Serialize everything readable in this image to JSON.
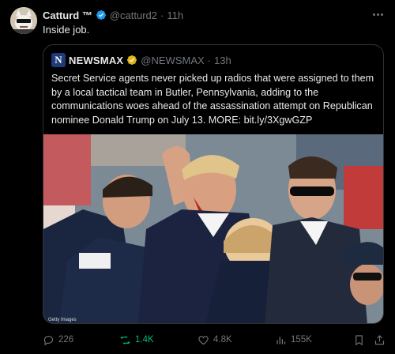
{
  "tweet": {
    "author_name": "Catturd ™",
    "handle": "@catturd2",
    "separator": "·",
    "time": "11h",
    "text": "Inside job."
  },
  "quote": {
    "logo_letter": "N",
    "author_name": "NEWSMAX",
    "handle": "@NEWSMAX",
    "separator": "·",
    "time": "13h",
    "text": "Secret Service agents never picked up radios that were assigned to them by a local tactical team in Butler, Pennsylvania, adding to the communications woes ahead of the assassination attempt on Republican nominee Donald Trump on July 13. MORE: bit.ly/3XgwGZP",
    "photo_credit": "Getty Images"
  },
  "actions": {
    "replies": "226",
    "retweets": "1.4K",
    "likes": "4.8K",
    "views": "155K"
  },
  "colors": {
    "background": "#000000",
    "text": "#e7e9ea",
    "muted": "#71767b",
    "verified_blue": "#1d9bf0",
    "verified_gold": "#e2b719",
    "retweet_green": "#00ba7c",
    "border": "#2f3336"
  }
}
